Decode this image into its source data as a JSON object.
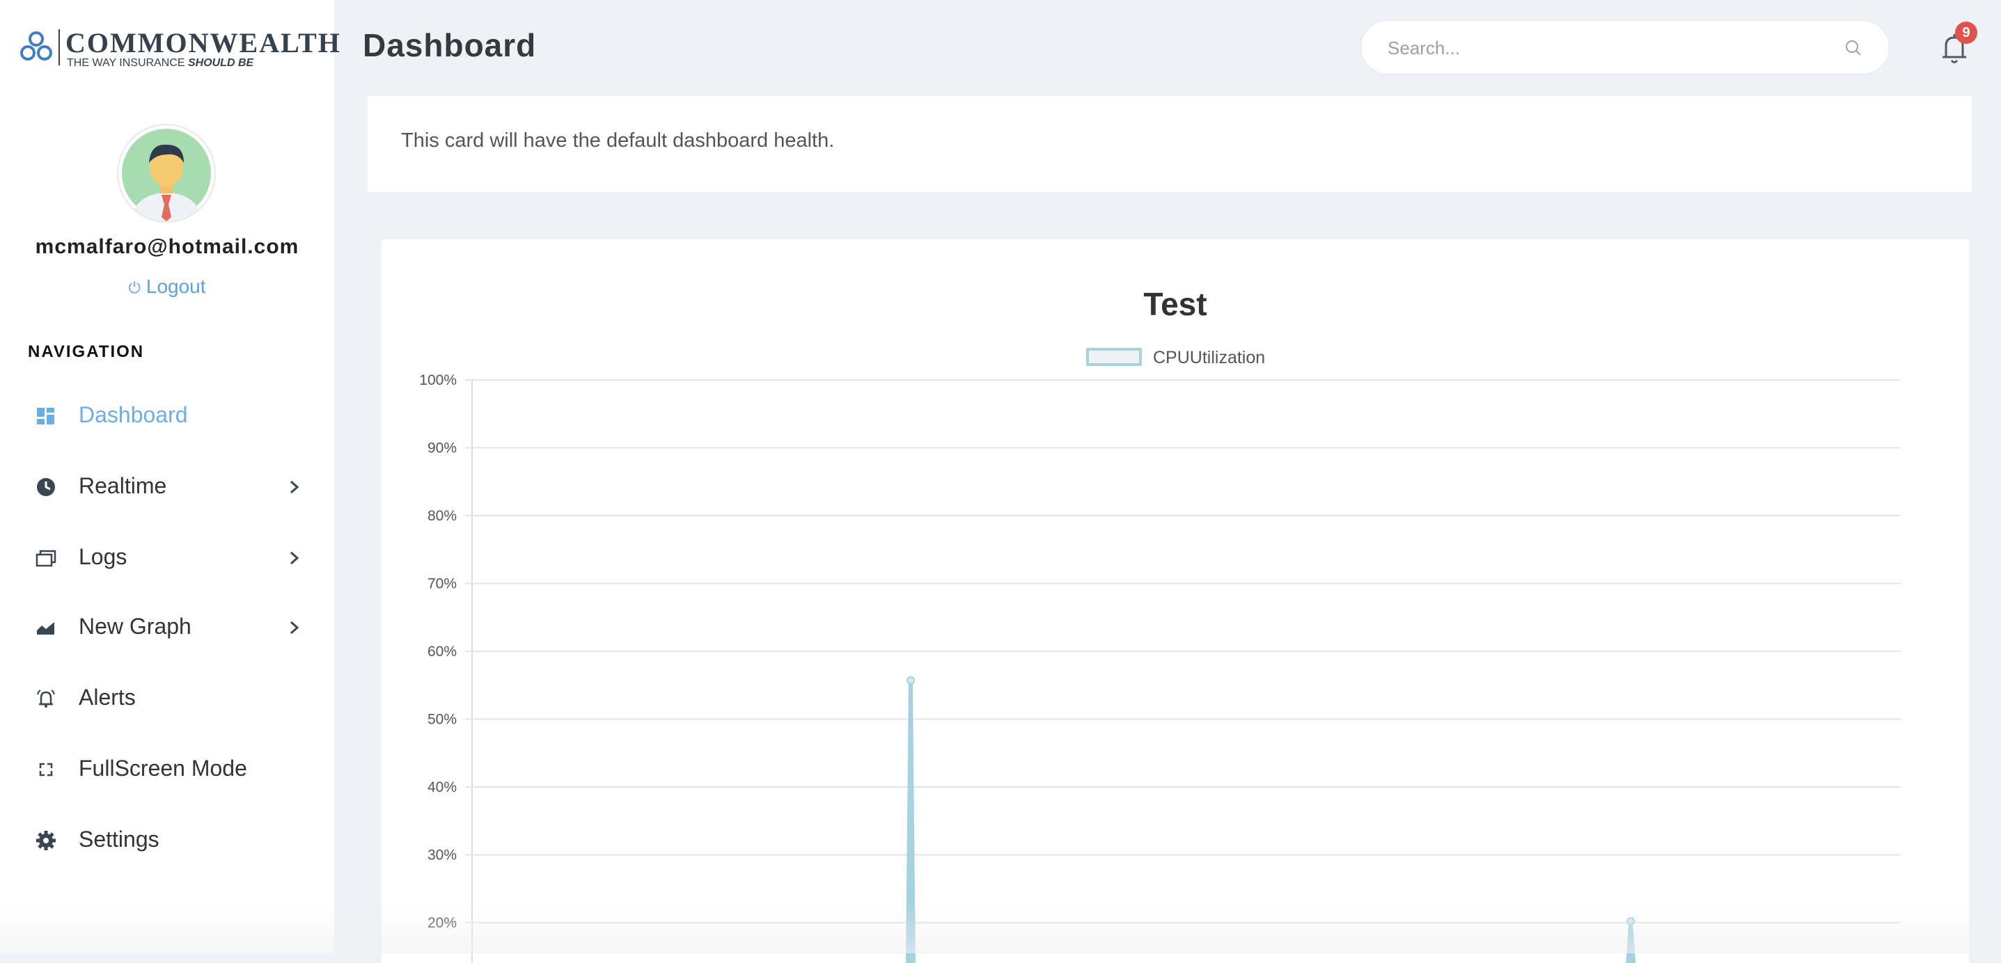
{
  "brand": {
    "name": "COMMONWEALTH",
    "tagline_prefix": "THE WAY INSURANCE ",
    "tagline_emphasis": "SHOULD BE"
  },
  "user": {
    "email": "mcmalfaro@hotmail.com",
    "logout_label": "Logout"
  },
  "navigation": {
    "heading": "NAVIGATION",
    "items": [
      {
        "label": "Dashboard",
        "icon": "dashboard-icon",
        "active": true,
        "has_submenu": false
      },
      {
        "label": "Realtime",
        "icon": "clock-icon",
        "active": false,
        "has_submenu": true
      },
      {
        "label": "Logs",
        "icon": "folders-icon",
        "active": false,
        "has_submenu": true
      },
      {
        "label": "New Graph",
        "icon": "area-chart-icon",
        "active": false,
        "has_submenu": true
      },
      {
        "label": "Alerts",
        "icon": "alarm-bell-icon",
        "active": false,
        "has_submenu": false
      },
      {
        "label": "FullScreen Mode",
        "icon": "fullscreen-icon",
        "active": false,
        "has_submenu": false
      },
      {
        "label": "Settings",
        "icon": "gear-icon",
        "active": false,
        "has_submenu": false
      }
    ]
  },
  "header": {
    "title": "Dashboard",
    "search_placeholder": "Search...",
    "notification_count": "9"
  },
  "health_card": {
    "text": "This card will have the default dashboard health."
  },
  "colors": {
    "accent": "#6aaee6",
    "series": "#a6d2e0",
    "badge": "#e0524d"
  },
  "chart_data": {
    "type": "line",
    "title": "Test",
    "series": [
      {
        "name": "CPUUtilization",
        "points": [
          {
            "position": 0.307,
            "value": 55.7
          },
          {
            "position": 0.811,
            "value": 20.2
          }
        ]
      }
    ],
    "y_ticks": [
      "100%",
      "90%",
      "80%",
      "70%",
      "60%",
      "50%",
      "40%",
      "30%",
      "20%"
    ],
    "ylim": [
      20,
      100
    ],
    "grid": true,
    "legend_position": "top-center"
  }
}
